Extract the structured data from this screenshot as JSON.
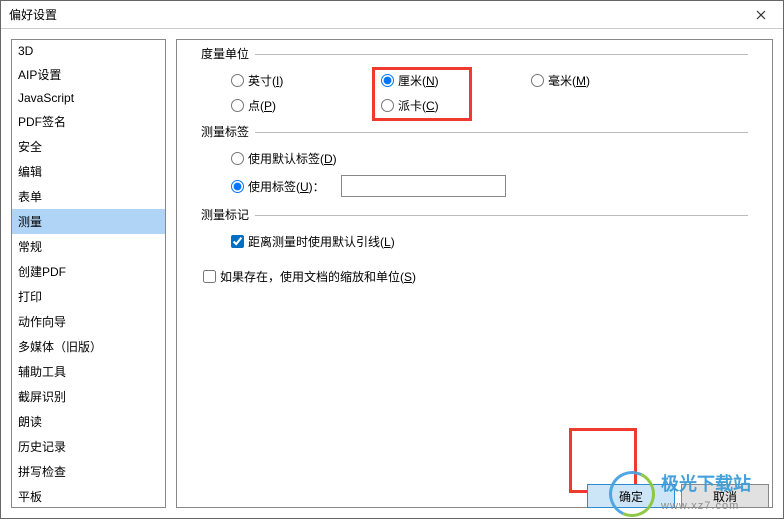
{
  "dialog": {
    "title": "偏好设置"
  },
  "sidebar": {
    "items": [
      {
        "label": "3D"
      },
      {
        "label": "AIP设置"
      },
      {
        "label": "JavaScript"
      },
      {
        "label": "PDF签名"
      },
      {
        "label": "安全"
      },
      {
        "label": "编辑"
      },
      {
        "label": "表单"
      },
      {
        "label": "测量"
      },
      {
        "label": "常规"
      },
      {
        "label": "创建PDF"
      },
      {
        "label": "打印"
      },
      {
        "label": "动作向导"
      },
      {
        "label": "多媒体（旧版）"
      },
      {
        "label": "辅助工具"
      },
      {
        "label": "截屏识别"
      },
      {
        "label": "朗读"
      },
      {
        "label": "历史记录"
      },
      {
        "label": "拼写检查"
      },
      {
        "label": "平板"
      }
    ],
    "selected_index": 7
  },
  "section_units": {
    "legend": "度量单位",
    "options": {
      "inch": {
        "pre": "英寸(",
        "u": "I",
        "post": ")"
      },
      "cm": {
        "pre": "厘米(",
        "u": "N",
        "post": ")"
      },
      "mm": {
        "pre": "毫米(",
        "u": "M",
        "post": ")"
      },
      "point": {
        "pre": "点(",
        "u": "P",
        "post": ")"
      },
      "pica": {
        "pre": "派卡(",
        "u": "C",
        "post": ")"
      }
    },
    "selected": "cm"
  },
  "section_label": {
    "legend": "测量标签",
    "default": {
      "pre": "使用默认标签(",
      "u": "D",
      "post": ")"
    },
    "custom": {
      "pre": "使用标签(",
      "u": "U",
      "post": ")："
    },
    "selected": "custom",
    "value": ""
  },
  "section_mark": {
    "legend": "测量标记",
    "leader": {
      "pre": "距离测量时使用默认引线(",
      "u": "L",
      "post": ")"
    },
    "leader_checked": true
  },
  "scale_exists": {
    "pre": "如果存在，使用文档的缩放和单位(",
    "u": "S",
    "post": ")",
    "checked": false
  },
  "footer": {
    "ok": "确定",
    "cancel": "取消"
  },
  "watermark": {
    "brand": "极光下载站",
    "url": "www.xz7.com"
  }
}
